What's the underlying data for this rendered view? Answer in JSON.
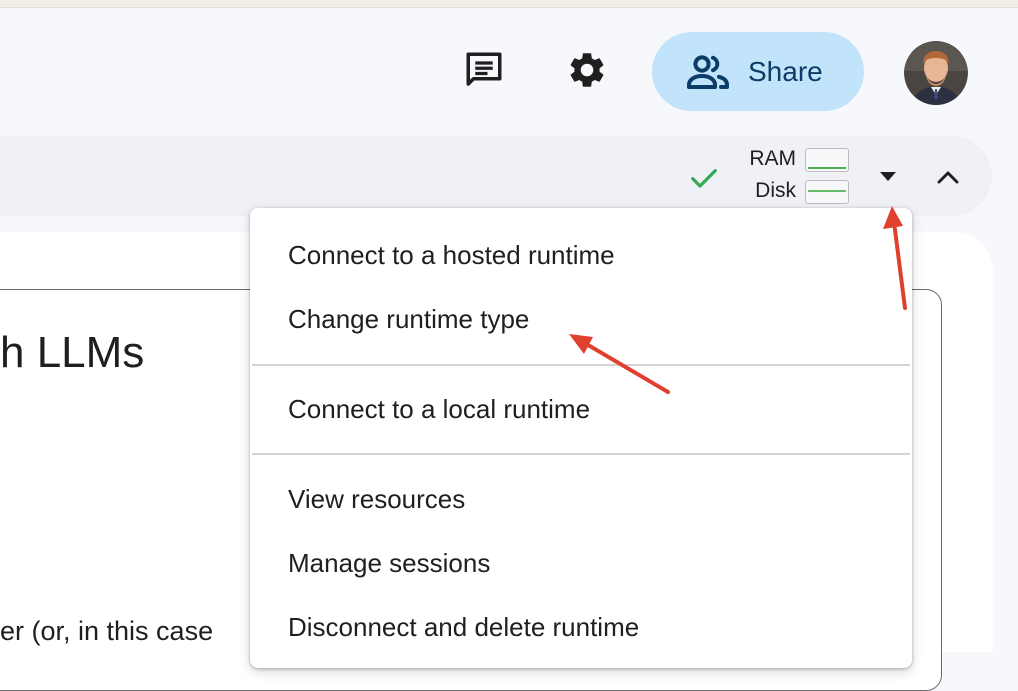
{
  "header": {
    "comments_icon": "comments-icon",
    "settings_icon": "gear-icon",
    "share": {
      "label": "Share",
      "icon": "people-icon"
    },
    "avatar": "user-avatar"
  },
  "runtime_toolbar": {
    "status_icon": "checkmark-icon",
    "ram_label": "RAM",
    "disk_label": "Disk",
    "dropdown_icon": "caret-down-icon",
    "collapse_icon": "chevron-up-icon"
  },
  "notebook": {
    "heading_fragment": "h LLMs",
    "text_fragment": "er (or, in this case"
  },
  "runtime_menu": {
    "items": [
      {
        "label": "Connect to a hosted runtime"
      },
      {
        "label": "Change runtime type"
      },
      {
        "label": "Connect to a local runtime"
      },
      {
        "label": "View resources"
      },
      {
        "label": "Manage sessions"
      },
      {
        "label": "Disconnect and delete runtime"
      }
    ]
  },
  "colors": {
    "accent_share_bg": "#c2e4fb",
    "annotation_arrow": "#e0412e",
    "status_green": "#34a853"
  }
}
